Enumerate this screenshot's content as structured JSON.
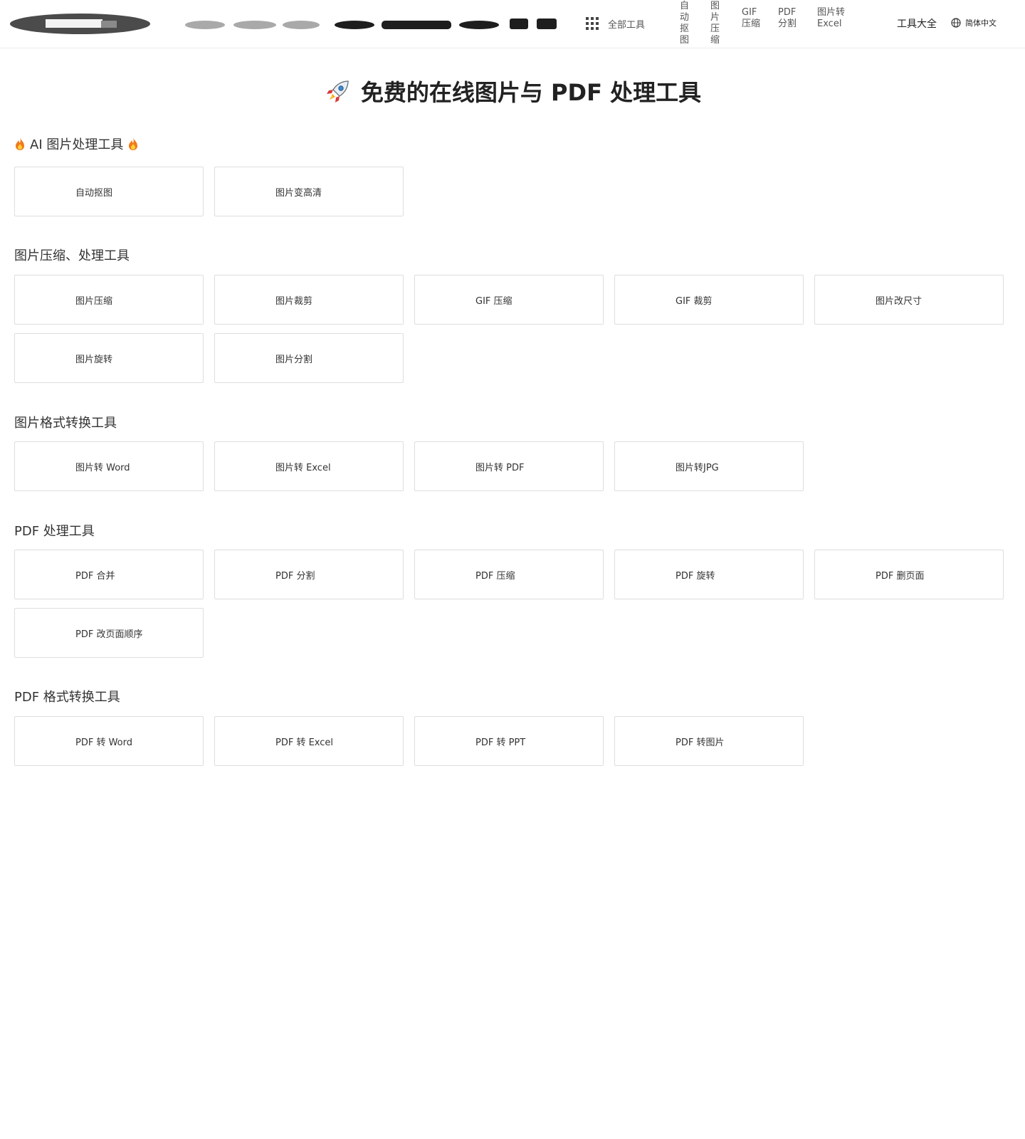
{
  "header": {
    "all_tools_label": "全部工具",
    "nav_items": [
      {
        "label": "自动抠图"
      },
      {
        "label": "图片压缩"
      },
      {
        "label": "GIF 压缩"
      },
      {
        "label": "PDF 分割"
      },
      {
        "label": "图片转 Excel"
      }
    ],
    "tools_all": "工具大全",
    "language": "简体中文"
  },
  "page_title": "免费的在线图片与 PDF 处理工具",
  "sections": [
    {
      "title": "AI 图片处理工具",
      "tools": [
        "自动抠图",
        "图片变高清"
      ]
    },
    {
      "title": "图片压缩、处理工具",
      "tools": [
        "图片压缩",
        "图片裁剪",
        "GIF 压缩",
        "GIF 裁剪",
        "图片改尺寸",
        "图片旋转",
        "图片分割"
      ]
    },
    {
      "title": "图片格式转换工具",
      "tools": [
        "图片转 Word",
        "图片转 Excel",
        "图片转 PDF",
        "图片转JPG"
      ]
    },
    {
      "title": "PDF 处理工具",
      "tools": [
        "PDF 合并",
        "PDF 分割",
        "PDF 压缩",
        "PDF 旋转",
        "PDF 删页面",
        "PDF 改页面顺序"
      ]
    },
    {
      "title": "PDF 格式转换工具",
      "tools": [
        "PDF 转 Word",
        "PDF 转 Excel",
        "PDF 转 PPT",
        "PDF 转图片"
      ]
    }
  ],
  "icons": {
    "logo": "logo-icon",
    "wordmark": "doc-small-wordmark",
    "grid": "grid-icon",
    "globe": "globe-icon",
    "rocket": "rocket-icon",
    "fire": "fire-icon"
  },
  "colors": {
    "fire": "#f07a1a",
    "card_border": "#dedede",
    "text": "#333333"
  }
}
